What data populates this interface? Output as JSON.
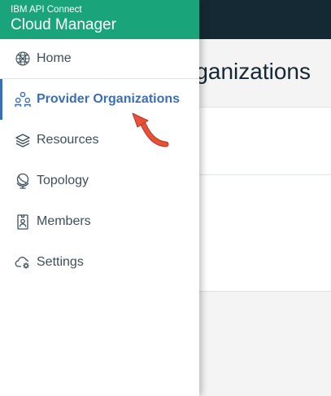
{
  "header": {
    "product_line": "IBM API Connect",
    "app_name": "Cloud Manager",
    "brand_color": "#1aa47a",
    "topbar_color": "#152935"
  },
  "main": {
    "page_title_partial": "rganizations"
  },
  "sidebar": {
    "accent_color": "#3b6fb4",
    "items": [
      {
        "label": "Home",
        "icon": "home-globe-icon",
        "active": false
      },
      {
        "label": "Provider Organizations",
        "icon": "provider-orgs-icon",
        "active": true
      },
      {
        "label": "Resources",
        "icon": "layers-icon",
        "active": false
      },
      {
        "label": "Topology",
        "icon": "topology-globe-icon",
        "active": false
      },
      {
        "label": "Members",
        "icon": "member-badge-icon",
        "active": false
      },
      {
        "label": "Settings",
        "icon": "cloud-gear-icon",
        "active": false
      }
    ]
  },
  "annotation": {
    "icon": "red-curved-arrow-icon",
    "color": "#e8503a"
  }
}
